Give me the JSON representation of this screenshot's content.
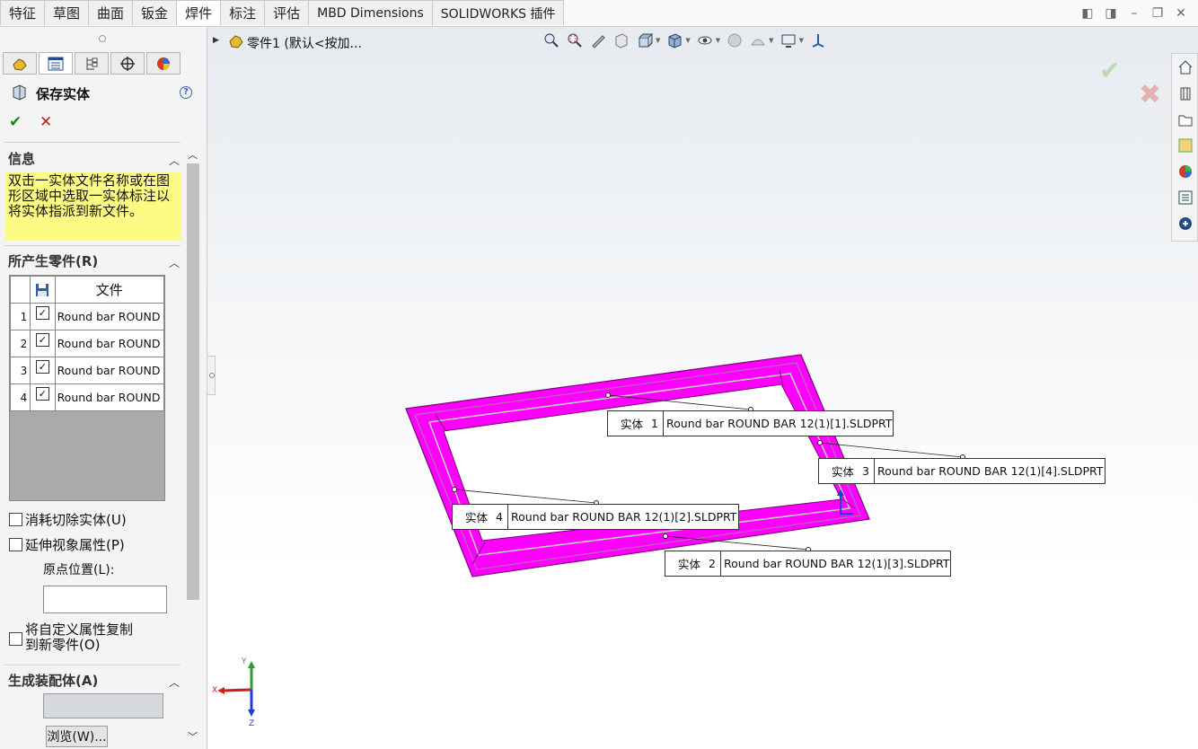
{
  "ribbon": {
    "tabs": [
      {
        "label": "特征"
      },
      {
        "label": "草图"
      },
      {
        "label": "曲面"
      },
      {
        "label": "钣金"
      },
      {
        "label": "焊件",
        "active": true
      },
      {
        "label": "标注"
      },
      {
        "label": "评估"
      },
      {
        "label": "MBD Dimensions"
      },
      {
        "label": "SOLIDWORKS 插件"
      }
    ]
  },
  "property_manager": {
    "title": "保存实体",
    "sections": {
      "info": "信息",
      "generated_parts": "所产生零件(R)",
      "create_assembly": "生成装配体(A)"
    },
    "message": "双击一实体文件名称或在图形区域中选取一实体标注以将实体指派到新文件。",
    "table": {
      "header_file": "文件",
      "rows": [
        {
          "num": "1",
          "file": "Round bar ROUND",
          "checked": true
        },
        {
          "num": "2",
          "file": "Round bar ROUND",
          "checked": true
        },
        {
          "num": "3",
          "file": "Round bar ROUND",
          "checked": true
        },
        {
          "num": "4",
          "file": "Round bar ROUND",
          "checked": true
        }
      ]
    },
    "options": {
      "consume_cut": "消耗切除实体(U)",
      "propagate_visual": "延伸视象属性(P)",
      "origin_location": "原点位置(L):",
      "copy_custom_line1": "将自定义属性复制",
      "copy_custom_line2": "到新零件(O)"
    },
    "browse_label": "浏览(W)..."
  },
  "graphics": {
    "tree_label": "零件1  (默认<按加...",
    "notes": [
      {
        "prefix": "实体",
        "num": "1",
        "file": "Round bar ROUND BAR 12(1)[1].SLDPRT"
      },
      {
        "prefix": "实体",
        "num": "3",
        "file": "Round bar ROUND BAR 12(1)[4].SLDPRT"
      },
      {
        "prefix": "实体",
        "num": "4",
        "file": "Round bar ROUND BAR 12(1)[2].SLDPRT"
      },
      {
        "prefix": "实体",
        "num": "2",
        "file": "Round bar ROUND BAR 12(1)[3].SLDPRT"
      }
    ],
    "triad": {
      "x": "X",
      "y": "Y",
      "z": "Z"
    }
  },
  "colors": {
    "model": "#ff00ff",
    "ok": "#1a8a1a",
    "cancel": "#c0201c",
    "message_bg": "#fcfc84"
  }
}
